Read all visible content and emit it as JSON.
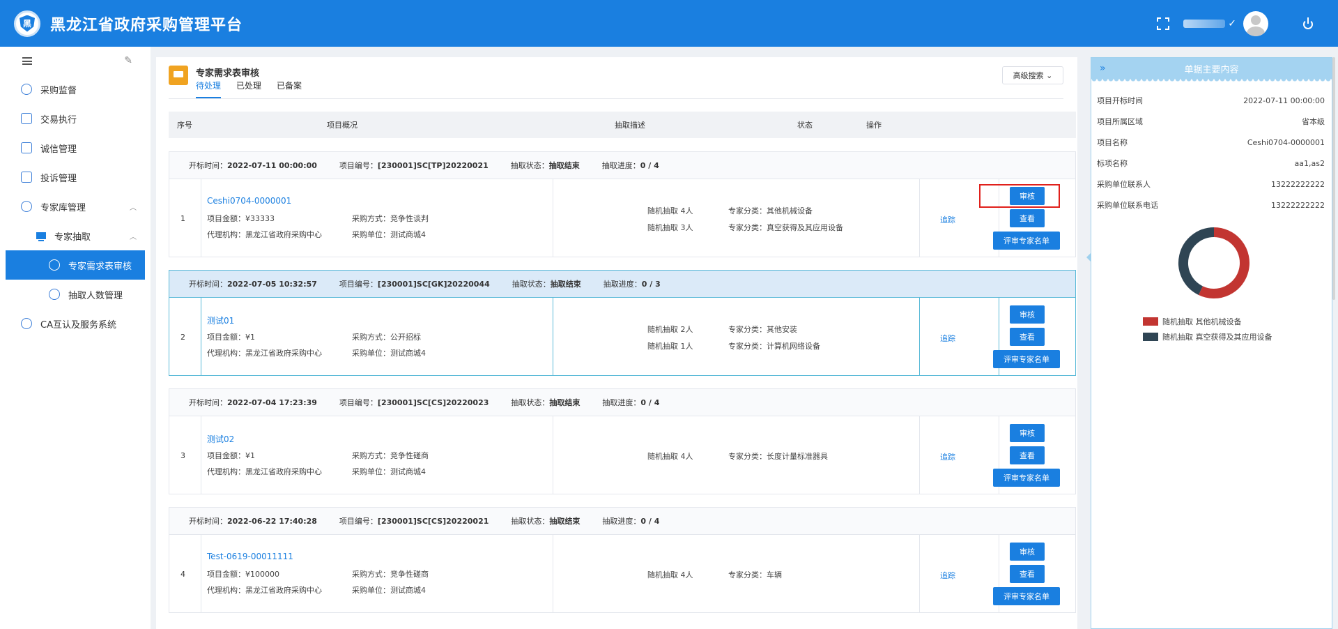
{
  "header": {
    "title": "黑龙江省政府采购管理平台",
    "logo_text": "黑"
  },
  "sidebar": {
    "items": [
      {
        "label": "采购监督"
      },
      {
        "label": "交易执行"
      },
      {
        "label": "诚信管理"
      },
      {
        "label": "投诉管理"
      },
      {
        "label": "专家库管理"
      },
      {
        "label": "专家抽取"
      },
      {
        "label": "专家需求表审核"
      },
      {
        "label": "抽取人数管理"
      },
      {
        "label": "CA互认及服务系统"
      }
    ]
  },
  "page": {
    "title": "专家需求表审核",
    "tabs": [
      "待处理",
      "已处理",
      "已备案"
    ],
    "adv_search": "高级搜索"
  },
  "table": {
    "headers": [
      "序号",
      "项目概况",
      "抽取描述",
      "状态",
      "操作"
    ],
    "labels": {
      "open_time": "开标时间：",
      "project_no": "项目编号：",
      "draw_status": "抽取状态：",
      "draw_progress": "抽取进度：",
      "amount": "项目金额：",
      "agency": "代理机构：",
      "method": "采购方式：",
      "unit": "采购单位：",
      "track": "追踪",
      "review": "审核",
      "view": "查看",
      "expert_list": "评审专家名单"
    },
    "groups": [
      {
        "open_time": "2022-07-11 00:00:00",
        "project_no": "[230001]SC[TP]20220021",
        "draw_status": "抽取结束",
        "progress": "0 / 4",
        "idx": "1",
        "name": "Ceshi0704-0000001",
        "amount": "¥33333",
        "method": "竞争性谈判",
        "agency": "黑龙江省政府采购中心",
        "unit": "测试商城4",
        "draws": [
          {
            "count": "随机抽取 4人",
            "category": "专家分类：其他机械设备"
          },
          {
            "count": "随机抽取 3人",
            "category": "专家分类：真空获得及其应用设备"
          }
        ]
      },
      {
        "open_time": "2022-07-05 10:32:57",
        "project_no": "[230001]SC[GK]20220044",
        "draw_status": "抽取结束",
        "progress": "0 / 3",
        "idx": "2",
        "name": "测试01",
        "amount": "¥1",
        "method": "公开招标",
        "agency": "黑龙江省政府采购中心",
        "unit": "测试商城4",
        "draws": [
          {
            "count": "随机抽取 2人",
            "category": "专家分类：其他安装"
          },
          {
            "count": "随机抽取 1人",
            "category": "专家分类：计算机网络设备"
          }
        ]
      },
      {
        "open_time": "2022-07-04 17:23:39",
        "project_no": "[230001]SC[CS]20220023",
        "draw_status": "抽取结束",
        "progress": "0 / 4",
        "idx": "3",
        "name": "测试02",
        "amount": "¥1",
        "method": "竞争性磋商",
        "agency": "黑龙江省政府采购中心",
        "unit": "测试商城4",
        "draws": [
          {
            "count": "随机抽取 4人",
            "category": "专家分类：长度计量标准器具"
          }
        ]
      },
      {
        "open_time": "2022-06-22 17:40:28",
        "project_no": "[230001]SC[CS]20220021",
        "draw_status": "抽取结束",
        "progress": "0 / 4",
        "idx": "4",
        "name": "Test-0619-00011111",
        "amount": "¥100000",
        "method": "竞争性磋商",
        "agency": "黑龙江省政府采购中心",
        "unit": "测试商城4",
        "draws": [
          {
            "count": "随机抽取 4人",
            "category": "专家分类：车辆"
          }
        ]
      }
    ]
  },
  "detail_panel": {
    "title": "单据主要内容",
    "rows": [
      {
        "label": "项目开标时间",
        "value": "2022-07-11 00:00:00"
      },
      {
        "label": "项目所属区域",
        "value": "省本级"
      },
      {
        "label": "项目名称",
        "value": "Ceshi0704-0000001"
      },
      {
        "label": "标项名称",
        "value": "aa1,as2"
      },
      {
        "label": "采购单位联系人",
        "value": "13222222222"
      },
      {
        "label": "采购单位联系电话",
        "value": "13222222222"
      }
    ],
    "chart_data": {
      "type": "pie",
      "categories": [
        "随机抽取 其他机械设备",
        "随机抽取 真空获得及其应用设备"
      ],
      "values": [
        4,
        3
      ],
      "colors": [
        "#c23531",
        "#2f4554"
      ]
    }
  }
}
